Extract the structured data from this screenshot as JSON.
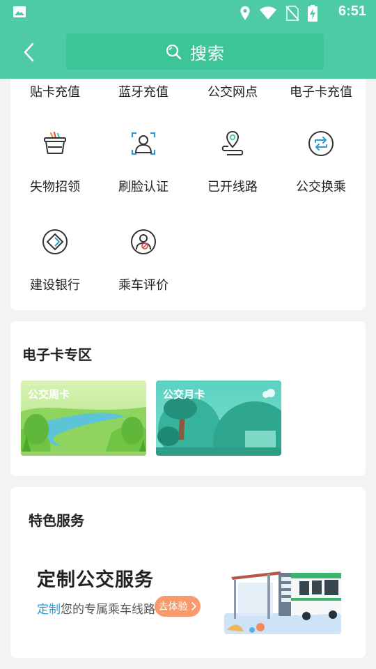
{
  "status_bar": {
    "time": "6:51"
  },
  "header": {
    "search_label": "搜索"
  },
  "services": {
    "top_row": [
      "贴卡充值",
      "蓝牙充值",
      "公交网点",
      "电子卡充值"
    ],
    "row2": [
      {
        "label": "失物招领",
        "icon": "lost-found-basket-icon"
      },
      {
        "label": "刷脸认证",
        "icon": "face-verify-icon"
      },
      {
        "label": "已开线路",
        "icon": "route-pin-icon"
      },
      {
        "label": "公交换乘",
        "icon": "transfer-cycle-icon"
      }
    ],
    "row3": [
      {
        "label": "建设银行",
        "icon": "ccb-bank-icon"
      },
      {
        "label": "乘车评价",
        "icon": "ride-review-icon"
      }
    ]
  },
  "ecard": {
    "title": "电子卡专区",
    "cards": [
      {
        "label": "公交周卡"
      },
      {
        "label": "公交月卡"
      }
    ]
  },
  "special": {
    "title": "特色服务",
    "promo_title": "定制公交服务",
    "promo_sub_highlight": "定制",
    "promo_sub_rest": "您的专属乘车线路",
    "promo_button": "去体验"
  },
  "colors": {
    "brand": "#4ecba4",
    "accent_orange": "#f79a6e",
    "accent_blue": "#2e9bd6"
  }
}
